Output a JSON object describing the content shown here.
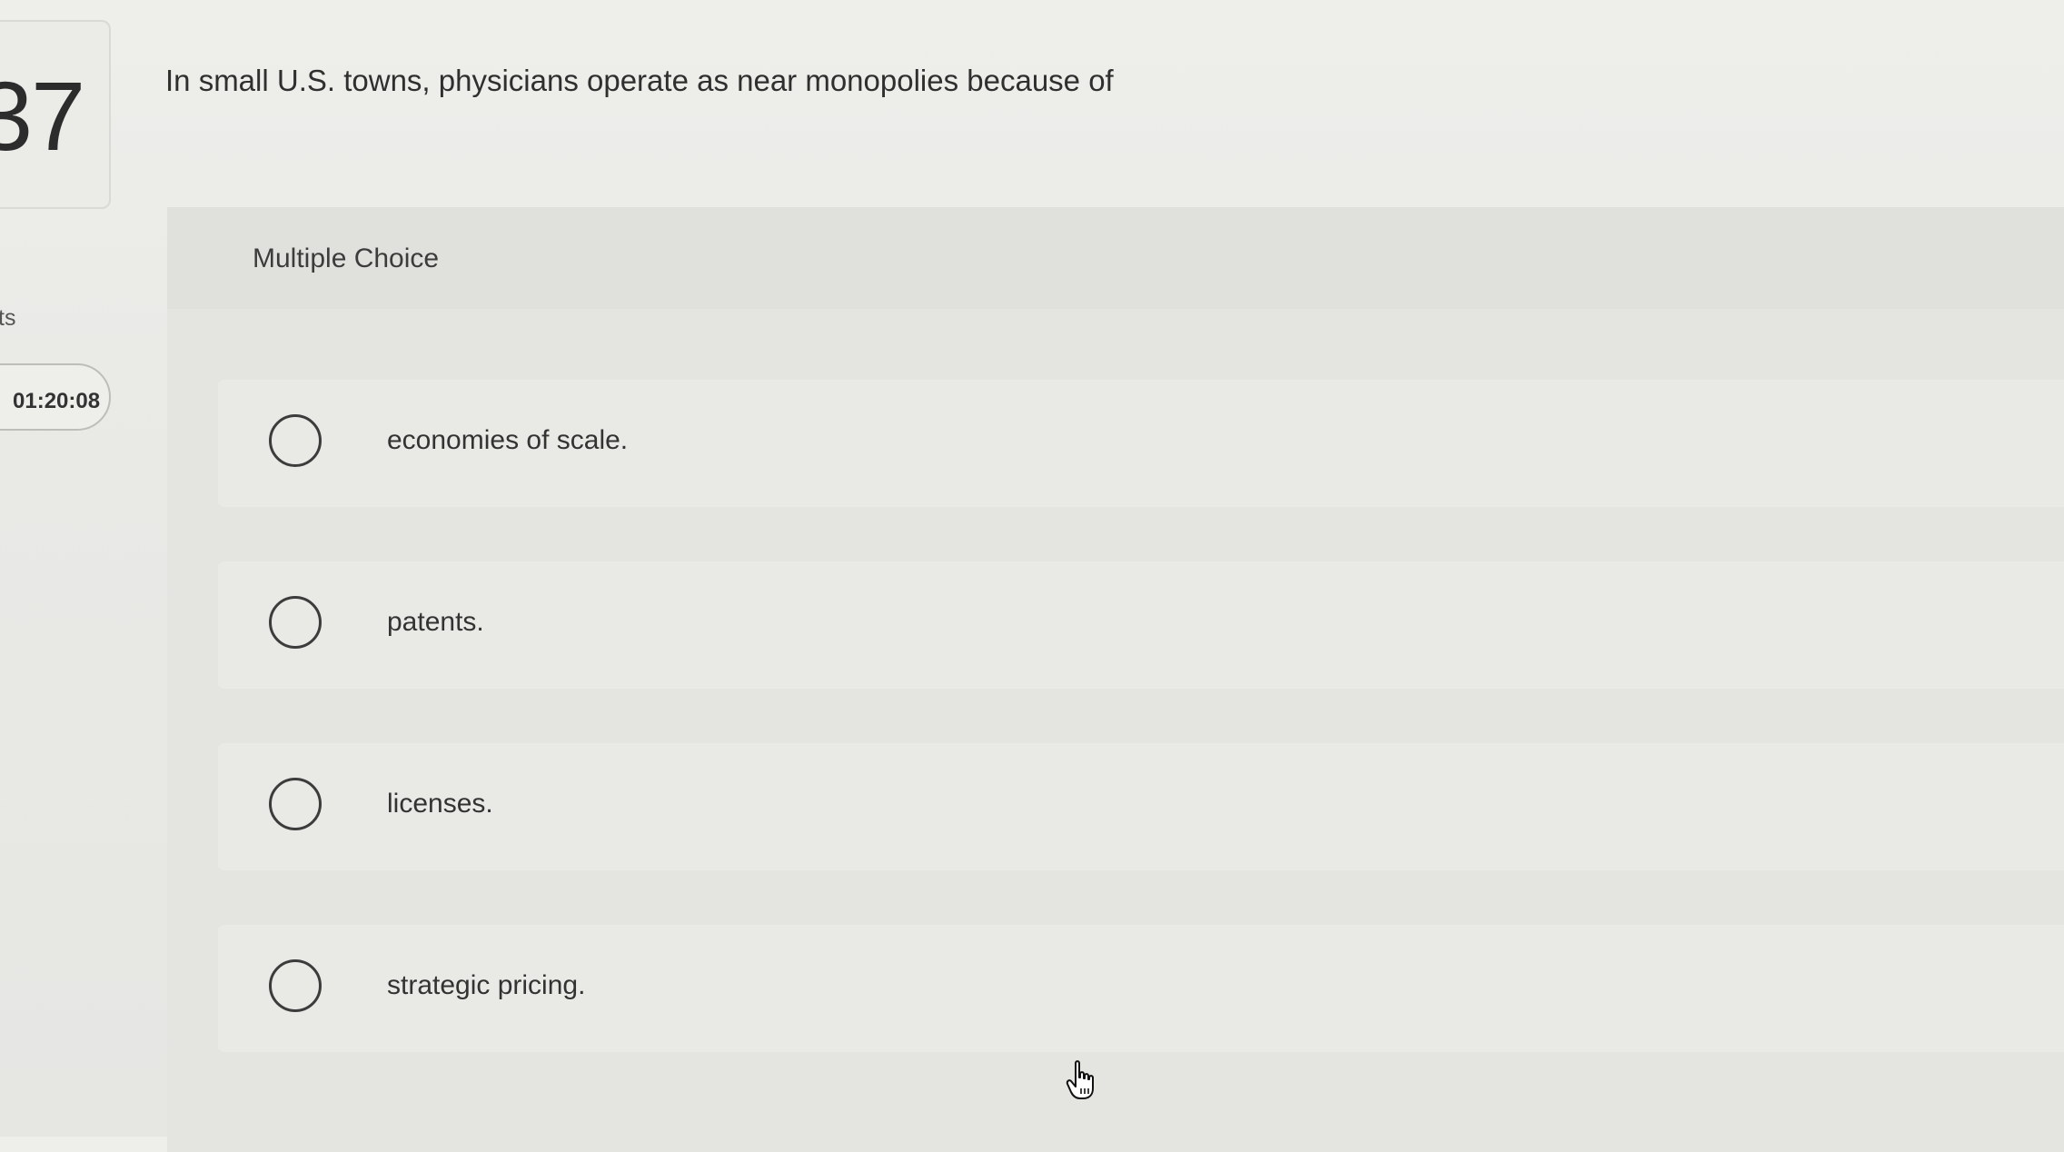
{
  "question": {
    "number": "37",
    "points_label": "ts",
    "timer": "01:20:08",
    "text": "In small U.S. towns, physicians operate as near monopolies because of"
  },
  "answer_panel": {
    "type_label": "Multiple Choice",
    "choices": [
      {
        "label": "economies of scale.",
        "selected": false
      },
      {
        "label": "patents.",
        "selected": false
      },
      {
        "label": "licenses.",
        "selected": false
      },
      {
        "label": "strategic pricing.",
        "selected": false
      }
    ]
  },
  "icons": {
    "cursor": "hand-pointer-icon"
  }
}
